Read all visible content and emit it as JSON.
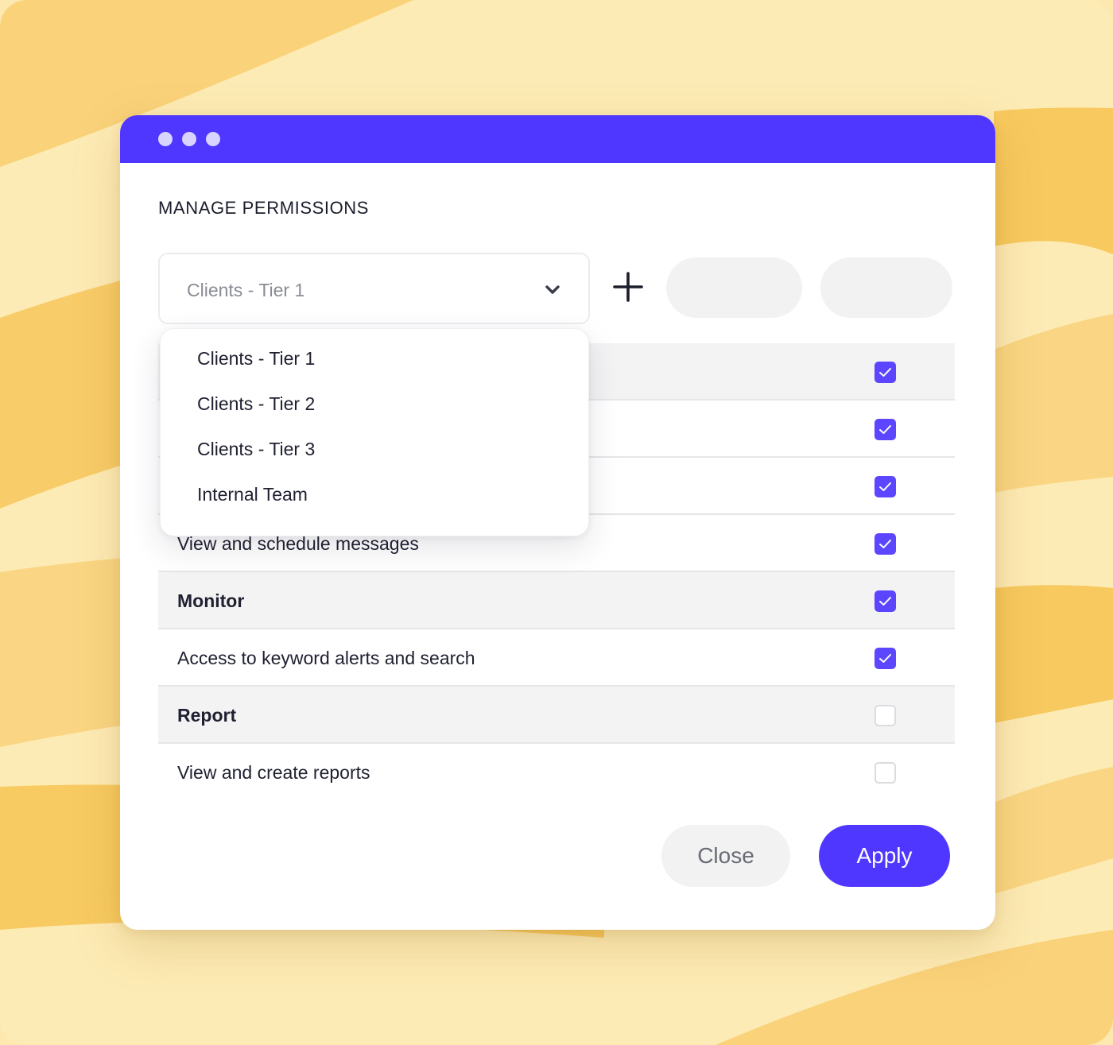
{
  "colors": {
    "accent": "#4f37ff",
    "background": "#fdebb5",
    "stripe": "#f8cf6e"
  },
  "window": {
    "title": "MANAGE PERMISSIONS",
    "controls": [
      "dot-icon",
      "dot-icon",
      "dot-icon"
    ]
  },
  "selector": {
    "value": "Clients - Tier 1",
    "icon": "chevron-down-icon",
    "options": [
      "Clients - Tier 1",
      "Clients - Tier 2",
      "Clients - Tier 3",
      "Internal Team"
    ]
  },
  "toolbar": {
    "add_icon": "plus-icon"
  },
  "permissions": [
    {
      "label": "",
      "group": true,
      "checked": true
    },
    {
      "label": "",
      "group": false,
      "checked": true
    },
    {
      "label": "",
      "group": false,
      "checked": true
    },
    {
      "label": "View and schedule messages",
      "group": false,
      "checked": true
    },
    {
      "label": "Monitor",
      "group": true,
      "checked": true
    },
    {
      "label": "Access to keyword alerts and search",
      "group": false,
      "checked": true
    },
    {
      "label": "Report",
      "group": true,
      "checked": false
    },
    {
      "label": "View and create reports",
      "group": false,
      "checked": false
    }
  ],
  "footer": {
    "close_label": "Close",
    "apply_label": "Apply"
  }
}
